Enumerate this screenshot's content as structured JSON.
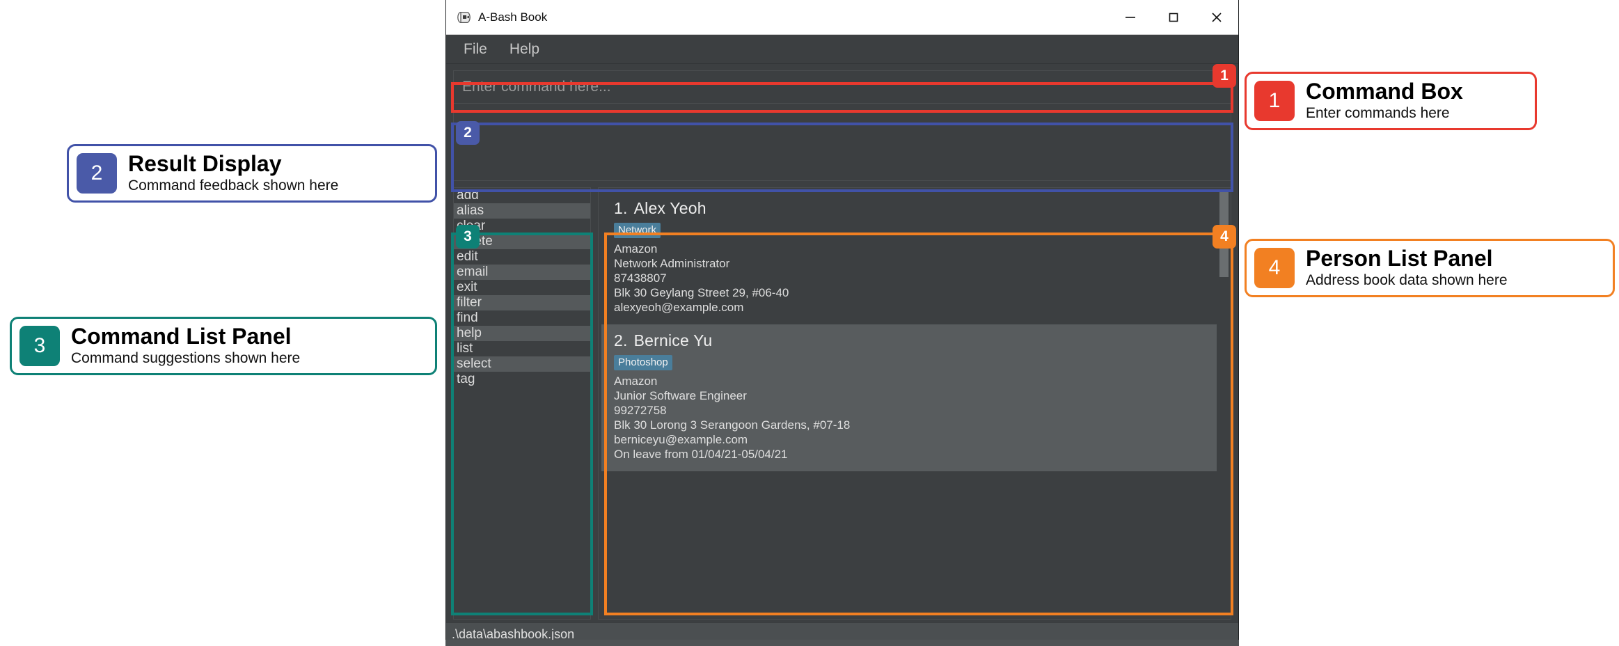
{
  "window": {
    "title": "A-Bash Book",
    "icon": "book-box-icon",
    "controls": {
      "minimize": "minimize-icon",
      "maximize": "maximize-icon",
      "close": "close-icon"
    }
  },
  "menubar": {
    "items": [
      {
        "label": "File"
      },
      {
        "label": "Help"
      }
    ]
  },
  "command_box": {
    "placeholder": "Enter command here...",
    "value": ""
  },
  "result_display": {
    "text": ""
  },
  "command_list": {
    "items": [
      "add",
      "alias",
      "clear",
      "delete",
      "edit",
      "email",
      "exit",
      "filter",
      "find",
      "help",
      "list",
      "select",
      "tag"
    ]
  },
  "person_list": {
    "persons": [
      {
        "index": "1.",
        "name": "Alex Yeoh",
        "tag": "Network",
        "company": "Amazon",
        "role": "Network Administrator",
        "phone": "87438807",
        "address": "Blk 30 Geylang Street 29, #06-40",
        "email": "alexyeoh@example.com",
        "note": "",
        "selected": false
      },
      {
        "index": "2.",
        "name": "Bernice Yu",
        "tag": "Photoshop",
        "company": "Amazon",
        "role": "Junior Software Engineer",
        "phone": "99272758",
        "address": "Blk 30 Lorong 3 Serangoon Gardens, #07-18",
        "email": "berniceyu@example.com",
        "note": "On leave from 01/04/21-05/04/21",
        "selected": true
      }
    ]
  },
  "status_bar": {
    "path": ".\\data\\abashbook.json"
  },
  "annotations": [
    {
      "number": "1",
      "title": "Command Box",
      "subtitle": "Enter commands here",
      "color": "#e8392e",
      "chip_color": "#e8392e"
    },
    {
      "number": "2",
      "title": "Result Display",
      "subtitle": "Command feedback shown here",
      "color": "#3b4aa8",
      "chip_color": "#4css"
    },
    {
      "number": "3",
      "title": "Command List Panel",
      "subtitle": "Command suggestions shown here",
      "color": "#0e8176",
      "chip_color": "#0e8176"
    },
    {
      "number": "4",
      "title": "Person List Panel",
      "subtitle": "Address book data shown here",
      "color": "#f28022",
      "chip_color": "#f28022"
    }
  ],
  "colors": {
    "red": "#e8392e",
    "blue": "#4152a8",
    "teal": "#0e8176",
    "orange": "#f28022",
    "chip_blue": "#4a5aa8",
    "tag_blue": "#4a7e9b",
    "app_bg": "#3c3f41"
  }
}
